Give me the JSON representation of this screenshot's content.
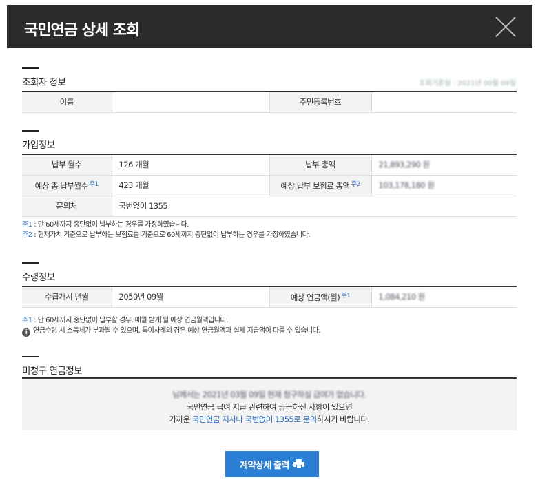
{
  "header": {
    "title": "국민연금 상세 조회"
  },
  "inquirer": {
    "title": "조회자 정보",
    "as_of": "조회기준일 : 2021년 00월 09일",
    "name_label": "이름",
    "name_value": "",
    "rrn_label": "주민등록번호",
    "rrn_value": ""
  },
  "subscription": {
    "title": "가입정보",
    "paid_months_label": "납부 월수",
    "paid_months_value": "126 개월",
    "paid_total_label": "납부 총액",
    "paid_total_value": "21,893,290 원",
    "expected_months_label": "예상 총 납부월수",
    "expected_months_note": "주1",
    "expected_months_value": "423 개월",
    "expected_premium_label": "예상 납부 보험료 총액",
    "expected_premium_note": "주2",
    "expected_premium_value": "103,178,180 원",
    "contact_label": "문의처",
    "contact_value": "국번없이 1355",
    "note1_tag": "주1",
    "note1_text": " : 만 60세까지 중단없이 납부하는 경우를 가정하였습니다.",
    "note2_tag": "주2",
    "note2_text": " : 현재가치 기준으로 납부하는 보험료를 기준으로 60세까지 중단없이 납부하는 경우를 가정하였습니다."
  },
  "receipt": {
    "title": "수령정보",
    "start_label": "수급개시 년월",
    "start_value": "2050년 09월",
    "monthly_label": "예상 연금액(월)",
    "monthly_note": "주1",
    "monthly_value": "1,084,210 원",
    "note1_tag": "주1",
    "note1_text": " : 만 60세까지 중단없이 납부할 경우, 매월 받게 될 예상 연금월액입니다.",
    "info_icon": "i",
    "info_text": "연금수령 시 소득세가 부과될 수 있으며, 특이사례의 경우 예상 연금월액과 실제 지급액이 다를 수 있습니다."
  },
  "unclaimed": {
    "title": "미청구 연금정보",
    "line1": "님께서는 2021년 03월 09일 현재 청구하실 급여가 없습니다.",
    "line2": "국민연금 급여 지급 관련하여 궁금하신 사항이 있으면",
    "line3_prefix": "가까운 ",
    "line3_link": "국민연금 지사나 국번없이 1355로 문의",
    "line3_suffix": "하시기 바랍니다."
  },
  "print_button": {
    "label": "계약상세 출력"
  },
  "colors": {
    "header_bg": "#2b2b2b",
    "accent": "#2a7fd4",
    "note_blue": "#2a6fc2"
  }
}
